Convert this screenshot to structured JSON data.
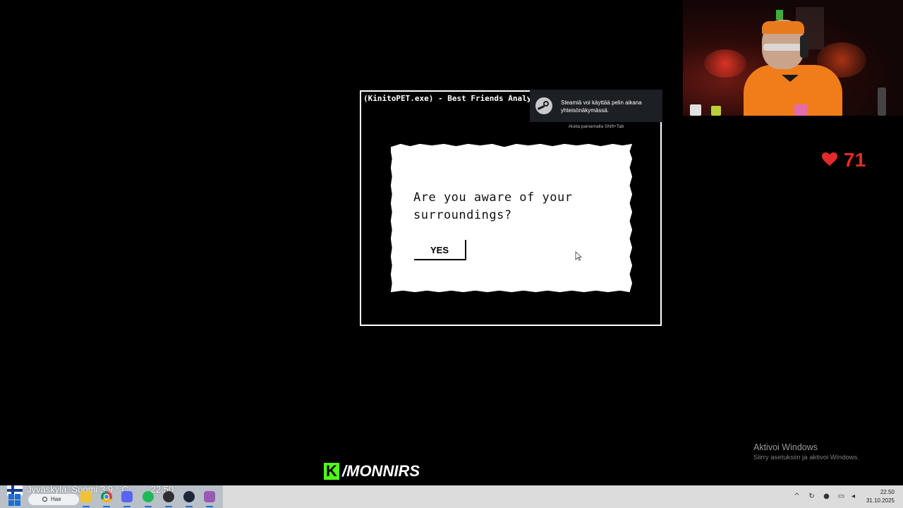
{
  "game": {
    "window_title": "(KinitoPET.exe) - Best Friends Analysis Hub",
    "question": "Are you aware of your surroundings?",
    "yes_label": "YES"
  },
  "steam_toast": {
    "message": "Steamiä voi käyttää pelin aikana yhteisönäkymässä.",
    "hint": "Aloita painamalla Shift+Tab"
  },
  "overlay": {
    "heart_count": "71",
    "heart_color": "#e22a2a",
    "channel_k": "K",
    "channel_name": "/MONNIRS",
    "kick_color": "#53fc18"
  },
  "activate_windows": {
    "title": "Aktivoi Windows",
    "subtitle": "Siirry asetuksiin ja aktivoi Windows."
  },
  "taskbar": {
    "weather": "Jyväskylä, Suomi   3.9 ° C",
    "weather_time": "22.50",
    "search_label": "Hae",
    "icons": [
      "start-icon",
      "folder-icon",
      "chrome-icon",
      "discord-icon",
      "spotify-icon",
      "obs-icon",
      "steam-icon",
      "app-icon"
    ],
    "clock_time": "22.50",
    "clock_date": "31.10.2025",
    "tray_icons": [
      "chevron-up-icon",
      "sync-icon",
      "microphone-icon",
      "display-icon",
      "volume-icon"
    ]
  }
}
